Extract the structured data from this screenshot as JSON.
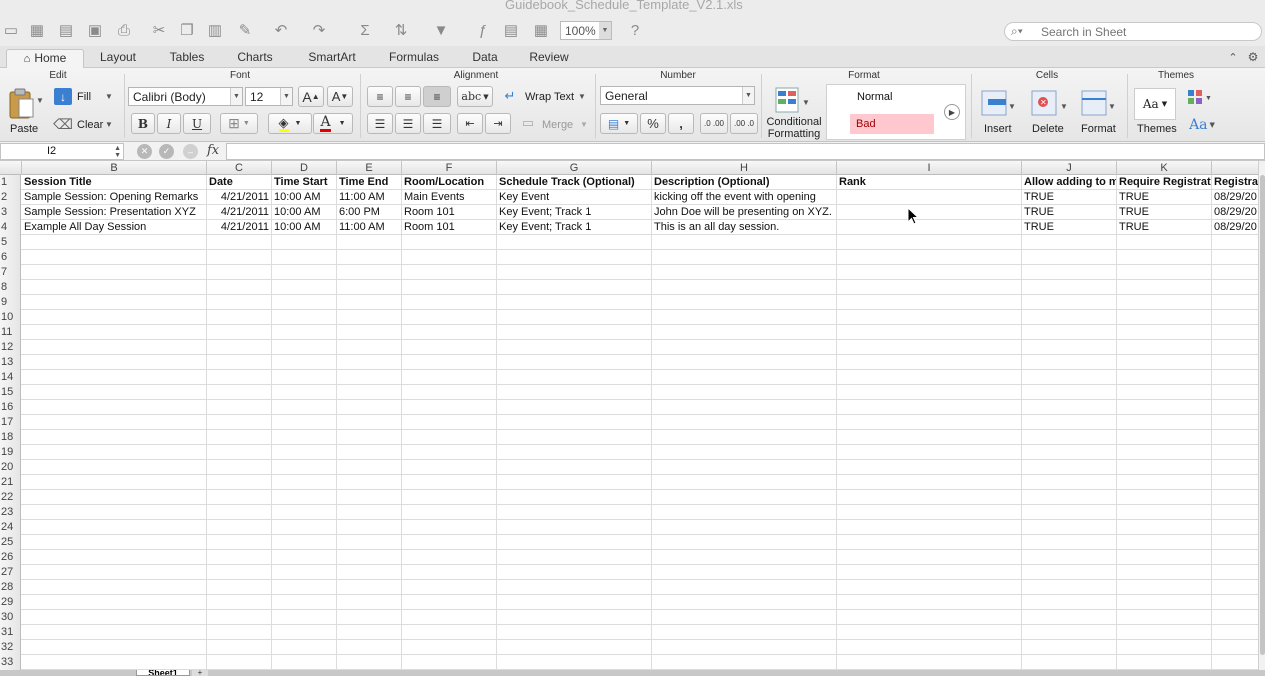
{
  "window": {
    "title": "Guidebook_Schedule_Template_V2.1.xls"
  },
  "toolbar": {
    "zoom": "100%",
    "search_placeholder": "Search in Sheet"
  },
  "ribbon_tabs": [
    {
      "label": "Home",
      "active": true
    },
    {
      "label": "Layout"
    },
    {
      "label": "Tables"
    },
    {
      "label": "Charts"
    },
    {
      "label": "SmartArt"
    },
    {
      "label": "Formulas"
    },
    {
      "label": "Data"
    },
    {
      "label": "Review"
    }
  ],
  "ribbon": {
    "groups": {
      "edit": "Edit",
      "font": "Font",
      "alignment": "Alignment",
      "number": "Number",
      "format": "Format",
      "cells": "Cells",
      "themes": "Themes"
    },
    "edit": {
      "paste": "Paste",
      "fill": "Fill",
      "clear": "Clear"
    },
    "font": {
      "name": "Calibri (Body)",
      "size": "12",
      "bold": "B",
      "italic": "I",
      "underline": "U",
      "grow": "A",
      "shrink": "A",
      "color_letter": "A"
    },
    "alignment": {
      "wrap_text": "Wrap Text",
      "merge": "Merge",
      "orientation": "abc"
    },
    "number": {
      "format": "General",
      "percent": "%",
      "comma": ",",
      "inc_decimal": ".0 .00",
      "dec_decimal": ".00 .0"
    },
    "format": {
      "conditional_line1": "Conditional",
      "conditional_line2": "Formatting",
      "style_normal": "Normal",
      "style_bad": "Bad"
    },
    "cells": {
      "insert": "Insert",
      "delete": "Delete",
      "format": "Format"
    },
    "themes": {
      "themes": "Themes",
      "fonts": "Aa"
    }
  },
  "formula_bar": {
    "cell_ref": "I2",
    "fx": "fx",
    "value": ""
  },
  "grid": {
    "columns": [
      {
        "letter": "B"
      },
      {
        "letter": "C"
      },
      {
        "letter": "D"
      },
      {
        "letter": "E"
      },
      {
        "letter": "F"
      },
      {
        "letter": "G"
      },
      {
        "letter": "H"
      },
      {
        "letter": "I"
      },
      {
        "letter": "J"
      },
      {
        "letter": "K"
      },
      {
        "letter": ""
      }
    ],
    "rows": [
      {
        "num": "1",
        "cells": [
          "Session Title",
          "Date",
          "Time Start",
          "Time End",
          "Room/Location",
          "Schedule Track (Optional)",
          "Description (Optional)",
          "Rank",
          "Allow adding to my",
          "Require Registration",
          "Registrat"
        ]
      },
      {
        "num": "2",
        "cells": [
          "Sample Session:  Opening Remarks",
          "4/21/2011",
          "10:00 AM",
          "11:00 AM",
          "Main Events",
          "Key Event",
          "kicking off the event with opening",
          "",
          "TRUE",
          "TRUE",
          "08/29/20"
        ]
      },
      {
        "num": "3",
        "cells": [
          "Sample Session:  Presentation XYZ",
          "4/21/2011",
          "10:00 AM",
          "6:00 PM",
          "Room 101",
          "Key Event; Track 1",
          "John Doe will be presenting on XYZ.",
          "",
          "TRUE",
          "TRUE",
          "08/29/20"
        ]
      },
      {
        "num": "4",
        "cells": [
          "Example All Day Session",
          "4/21/2011",
          "10:00 AM",
          "11:00 AM",
          "Room 101",
          "Key Event; Track 1",
          "This is an all day session.",
          "",
          "TRUE",
          "TRUE",
          "08/29/20"
        ]
      },
      {
        "num": "5",
        "cells": []
      },
      {
        "num": "6",
        "cells": []
      },
      {
        "num": "7",
        "cells": []
      },
      {
        "num": "8",
        "cells": []
      },
      {
        "num": "9",
        "cells": []
      },
      {
        "num": "10",
        "cells": []
      },
      {
        "num": "11",
        "cells": []
      },
      {
        "num": "12",
        "cells": []
      },
      {
        "num": "13",
        "cells": []
      },
      {
        "num": "14",
        "cells": []
      },
      {
        "num": "15",
        "cells": []
      },
      {
        "num": "16",
        "cells": []
      },
      {
        "num": "17",
        "cells": []
      },
      {
        "num": "18",
        "cells": []
      },
      {
        "num": "19",
        "cells": []
      },
      {
        "num": "20",
        "cells": []
      },
      {
        "num": "21",
        "cells": []
      },
      {
        "num": "22",
        "cells": []
      },
      {
        "num": "23",
        "cells": []
      },
      {
        "num": "24",
        "cells": []
      },
      {
        "num": "25",
        "cells": []
      },
      {
        "num": "26",
        "cells": []
      },
      {
        "num": "27",
        "cells": []
      },
      {
        "num": "28",
        "cells": []
      },
      {
        "num": "29",
        "cells": []
      },
      {
        "num": "30",
        "cells": []
      },
      {
        "num": "31",
        "cells": []
      },
      {
        "num": "32",
        "cells": []
      },
      {
        "num": "33",
        "cells": []
      }
    ]
  },
  "sheets": [
    {
      "label": "Sheet1",
      "active": true
    }
  ],
  "colors": {
    "bad_fill": "#ffc7ce",
    "bad_text": "#9c0006",
    "font_color_bar": "#e00000",
    "highlight_bar": "#ffff00"
  }
}
